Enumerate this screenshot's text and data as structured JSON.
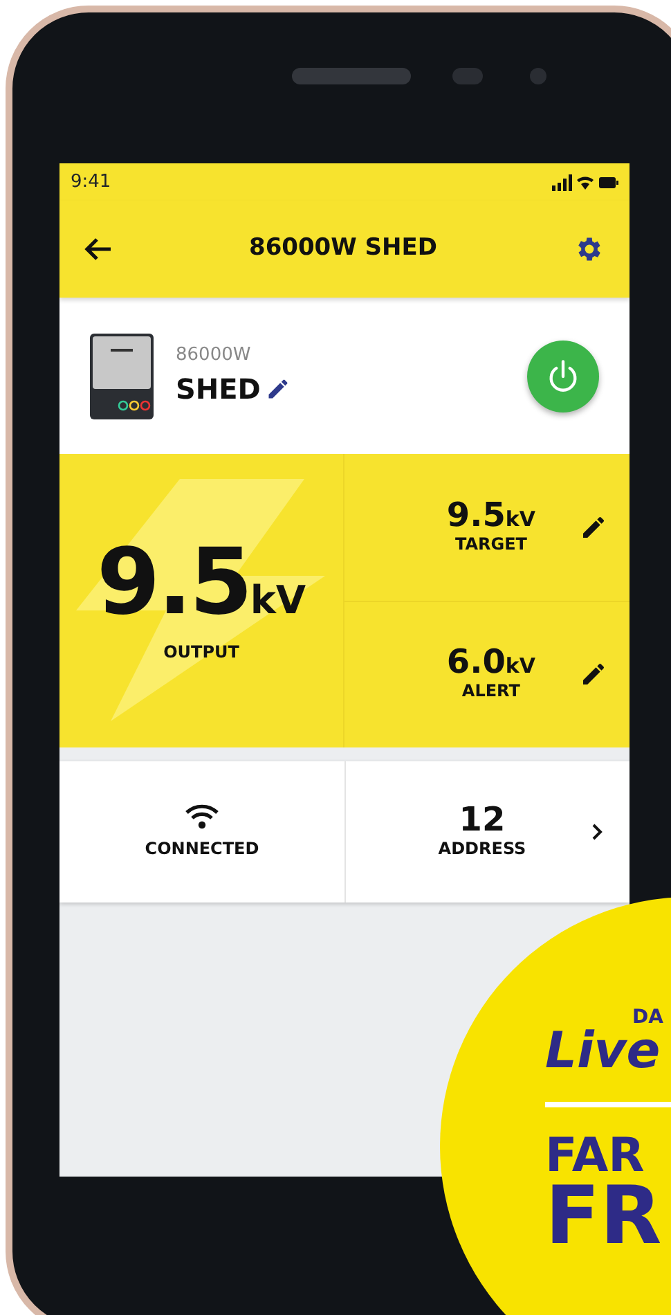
{
  "status_bar": {
    "time": "9:41"
  },
  "app_bar": {
    "title": "86000W SHED"
  },
  "device": {
    "model": "86000W",
    "name": "SHED",
    "power_on": true
  },
  "output": {
    "value": "9.5",
    "unit": "kV",
    "label": "OUTPUT"
  },
  "settings": [
    {
      "value": "9.5",
      "unit": "kV",
      "label": "TARGET"
    },
    {
      "value": "6.0",
      "unit": "kV",
      "label": "ALERT"
    }
  ],
  "connection": {
    "label": "CONNECTED"
  },
  "address": {
    "value": "12",
    "label": "ADDRESS"
  },
  "promo_badge": {
    "lines": [
      {
        "kind": "small",
        "text": "DA"
      },
      {
        "kind": "brand",
        "text": "Live"
      },
      {
        "kind": "headline",
        "text": "FAR"
      },
      {
        "kind": "huge",
        "text": "FR"
      }
    ]
  }
}
